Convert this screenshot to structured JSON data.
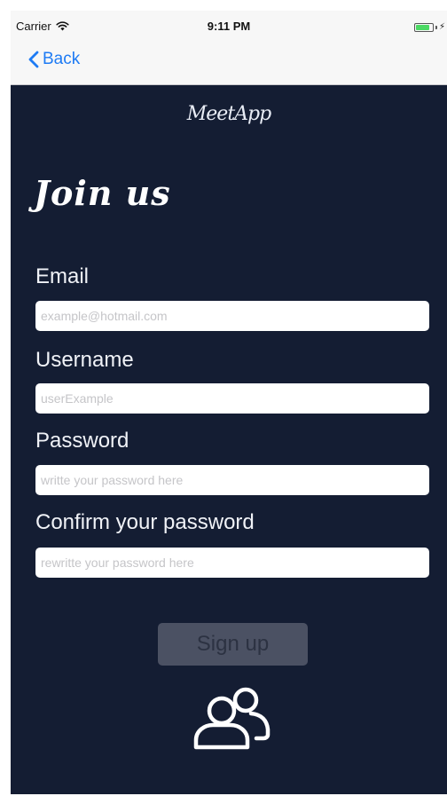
{
  "status_bar": {
    "carrier": "Carrier",
    "time": "9:11 PM",
    "battery_level": 0.85,
    "battery_color": "#4cd964"
  },
  "nav": {
    "back_label": "Back",
    "back_icon": "chevron-left-icon",
    "tint_color": "#1e7bf4"
  },
  "logo": {
    "text": "MeetApp"
  },
  "form": {
    "title": "Join us",
    "fields": [
      {
        "label": "Email",
        "placeholder": "example@hotmail.com",
        "value": ""
      },
      {
        "label": "Username",
        "placeholder": "userExample",
        "value": ""
      },
      {
        "label": "Password",
        "placeholder": "writte your password here",
        "value": ""
      },
      {
        "label": "Confirm your password",
        "placeholder": "rewritte your password here",
        "value": ""
      }
    ],
    "submit_label": "Sign up"
  },
  "footer": {
    "icon": "users-icon"
  },
  "colors": {
    "background": "#141d33",
    "button_background": "#4b5163",
    "button_text": "#2c3242"
  }
}
